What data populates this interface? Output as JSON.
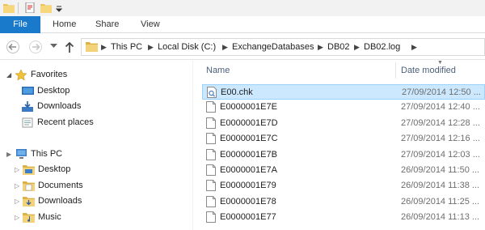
{
  "ribbon": {
    "file_tab": "File",
    "tabs": [
      "Home",
      "Share",
      "View"
    ]
  },
  "address": {
    "crumbs": [
      "This PC",
      "Local Disk (C:)",
      "ExchangeDatabases",
      "DB02",
      "DB02.log"
    ]
  },
  "nav_pane": {
    "favorites": {
      "label": "Favorites",
      "items": [
        "Desktop",
        "Downloads",
        "Recent places"
      ]
    },
    "this_pc": {
      "label": "This PC",
      "items": [
        "Desktop",
        "Documents",
        "Downloads",
        "Music"
      ]
    }
  },
  "file_list": {
    "columns": {
      "name": "Name",
      "date_modified": "Date modified"
    },
    "rows": [
      {
        "name": "E00.chk",
        "date": "27/09/2014 12:50 ...",
        "icon": "checkpoint-file-icon",
        "selected": true
      },
      {
        "name": "E0000001E7E",
        "date": "27/09/2014 12:40 ...",
        "icon": "file-icon"
      },
      {
        "name": "E0000001E7D",
        "date": "27/09/2014 12:28 ...",
        "icon": "file-icon"
      },
      {
        "name": "E0000001E7C",
        "date": "27/09/2014 12:16 ...",
        "icon": "file-icon"
      },
      {
        "name": "E0000001E7B",
        "date": "27/09/2014 12:03 ...",
        "icon": "file-icon"
      },
      {
        "name": "E0000001E7A",
        "date": "26/09/2014 11:50 ...",
        "icon": "file-icon"
      },
      {
        "name": "E0000001E79",
        "date": "26/09/2014 11:38 ...",
        "icon": "file-icon"
      },
      {
        "name": "E0000001E78",
        "date": "26/09/2014 11:25 ...",
        "icon": "file-icon"
      },
      {
        "name": "E0000001E77",
        "date": "26/09/2014 11:13 ...",
        "icon": "file-icon"
      }
    ]
  },
  "colors": {
    "file_tab": "#1979ca",
    "selection_fill": "#cce8ff",
    "selection_border": "#99d1ff",
    "column_header_text": "#4c607a",
    "folder": "#e8c45a"
  }
}
